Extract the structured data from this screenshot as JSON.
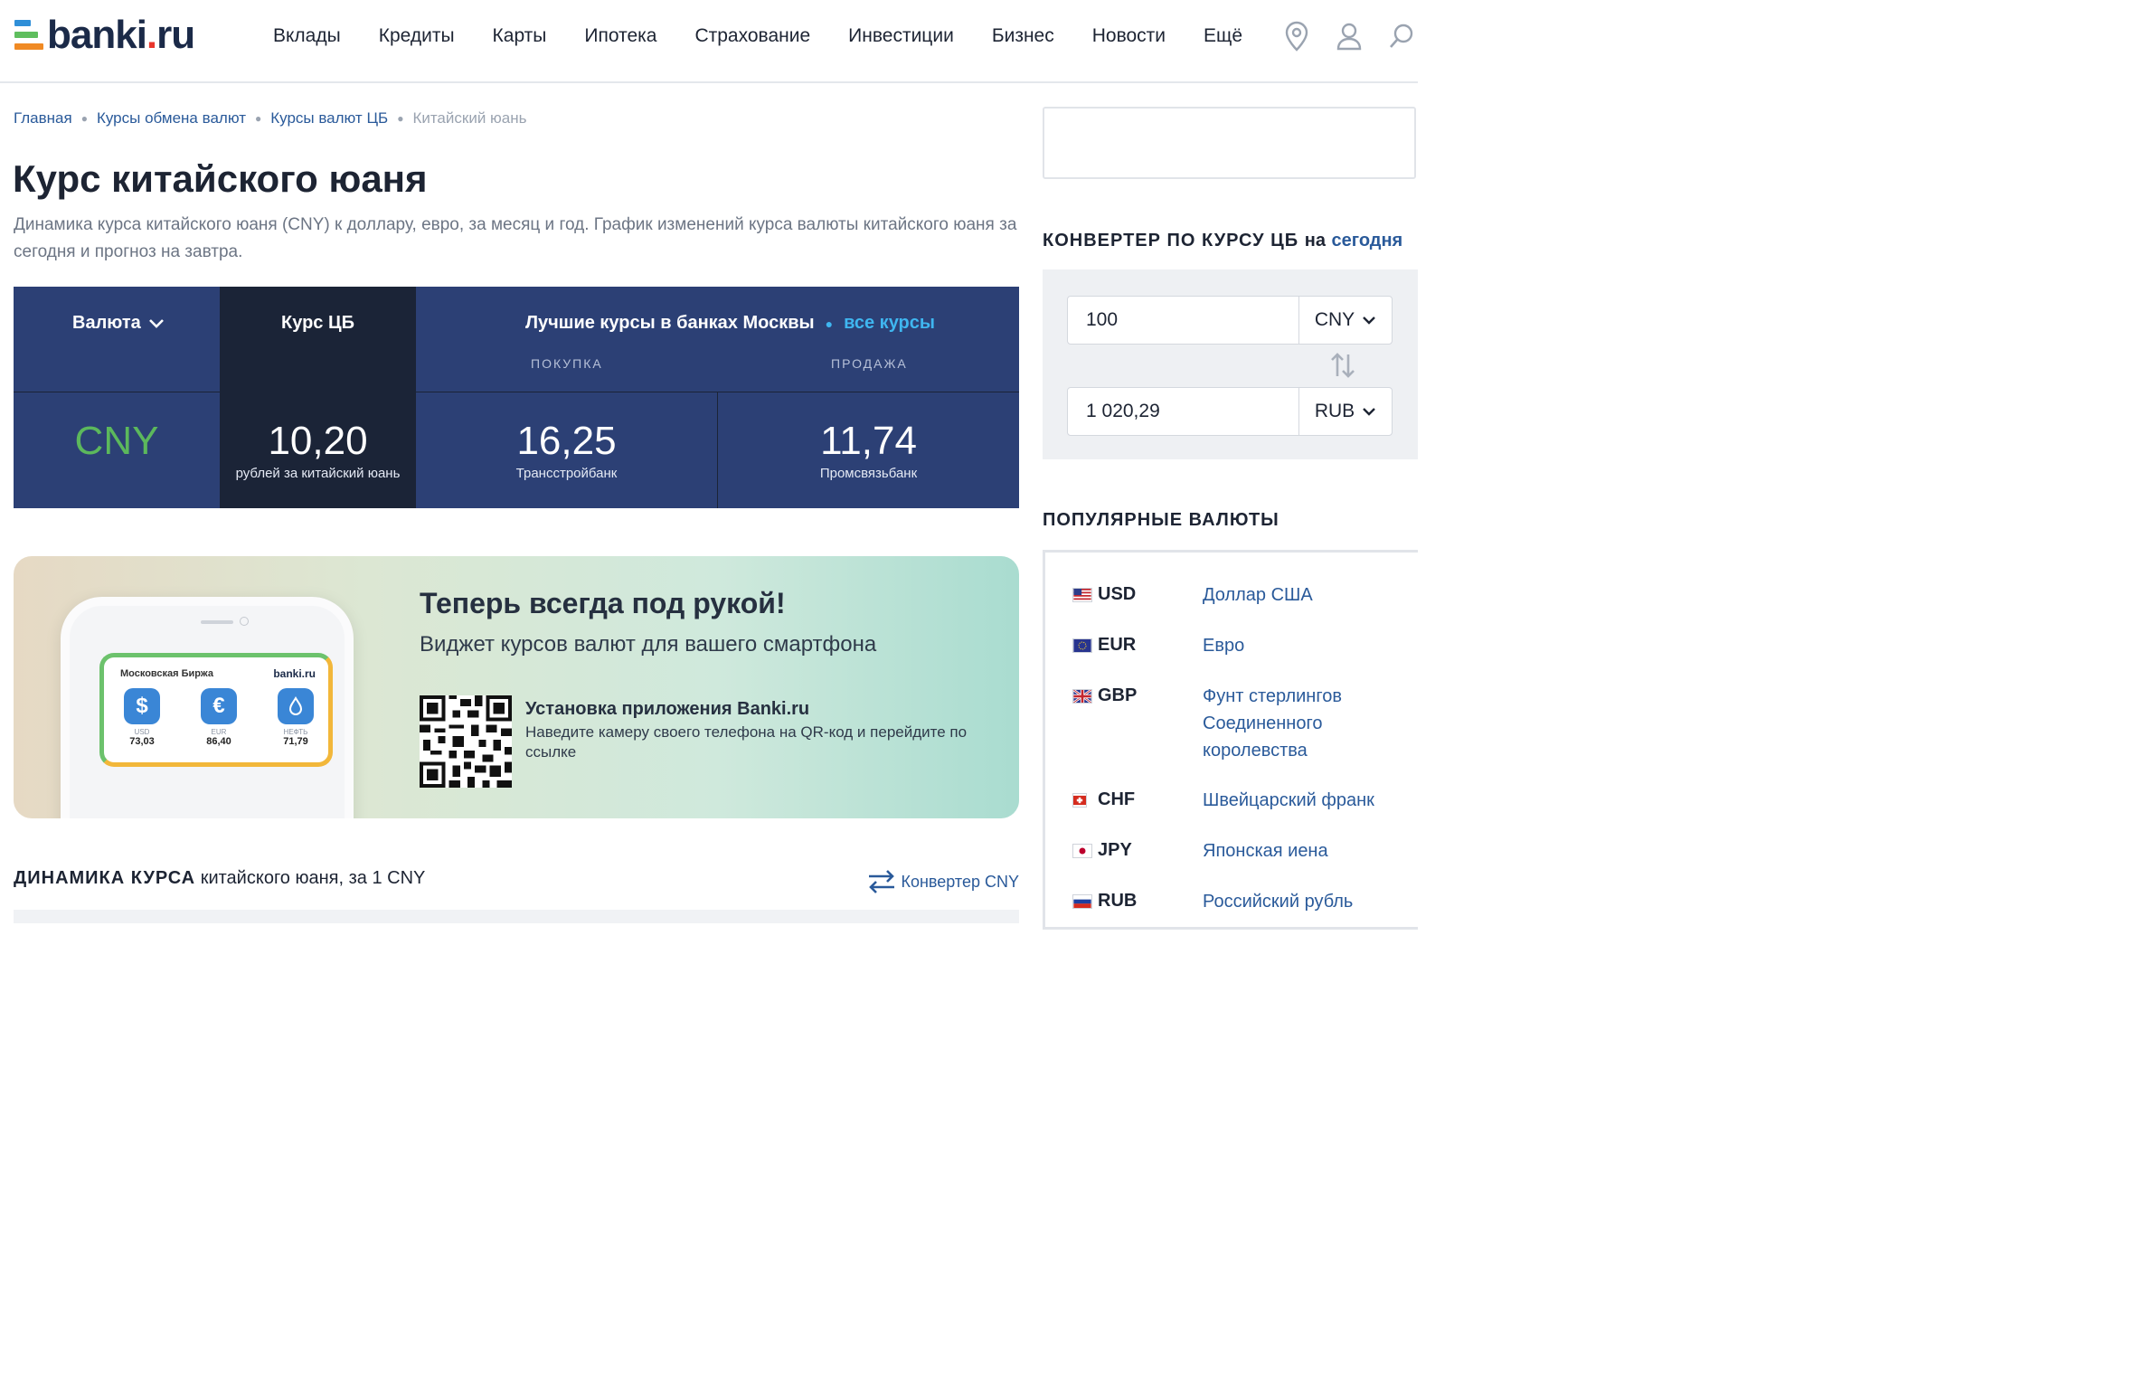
{
  "header": {
    "logo": "banki.ru",
    "nav": [
      "Вклады",
      "Кредиты",
      "Карты",
      "Ипотека",
      "Страхование",
      "Инвестиции",
      "Бизнес",
      "Новости",
      "Ещё"
    ],
    "icons": [
      "location-icon",
      "user-icon",
      "search-icon"
    ]
  },
  "breadcrumb": [
    "Главная",
    "Курсы обмена валют",
    "Курсы валют ЦБ",
    "Китайский юань"
  ],
  "page": {
    "title": "Курс китайского юаня",
    "description": "Динамика курса китайского юаня (CNY) к доллару, евро, за месяц и год. График изменений курса валюты китайского юаня за сегодня и прогноз на завтра."
  },
  "rates": {
    "col_currency": "Валюта",
    "col_cb": "Курс ЦБ",
    "col_best": "Лучшие курсы в банках Москвы",
    "all_rates_link": "все курсы",
    "buy_label": "ПОКУПКА",
    "sell_label": "ПРОДАЖА",
    "currency_code": "CNY",
    "cb_value": "10,20",
    "cb_caption": "рублей за китайский юань",
    "buy_value": "16,25",
    "buy_bank": "Трансстройбанк",
    "sell_value": "11,74",
    "sell_bank": "Промсвязьбанк"
  },
  "promo": {
    "title": "Теперь всегда под рукой!",
    "subtitle": "Виджет курсов валют для вашего смартфона",
    "install_title": "Установка приложения Banki.ru",
    "install_text": "Наведите камеру своего телефона на QR-код и перейдите по ссылке",
    "widget": {
      "exchange": "Московская Биржа",
      "logo": "banki.ru",
      "items": [
        {
          "symbol": "$",
          "label": "USD",
          "value": "73,03"
        },
        {
          "symbol": "€",
          "label": "EUR",
          "value": "86,40"
        },
        {
          "symbol": "💧",
          "label": "НЕФТЬ",
          "value": "71,79"
        }
      ]
    }
  },
  "dynamics": {
    "title_bold": "ДИНАМИКА КУРСА",
    "title_rest": "китайского юаня, за 1 CNY",
    "converter_link": "Конвертер CNY"
  },
  "converter": {
    "title": "КОНВЕРТЕР ПО КУРСУ ЦБ",
    "on": "на",
    "date_link": "сегодня",
    "from_value": "100",
    "from_currency": "CNY",
    "to_value": "1 020,29",
    "to_currency": "RUB"
  },
  "popular": {
    "title": "ПОПУЛЯРНЫЕ ВАЛЮТЫ",
    "items": [
      {
        "code": "USD",
        "name": "Доллар США"
      },
      {
        "code": "EUR",
        "name": "Евро"
      },
      {
        "code": "GBP",
        "name": "Фунт стерлингов Соединенного королевства"
      },
      {
        "code": "CHF",
        "name": "Швейцарский франк"
      },
      {
        "code": "JPY",
        "name": "Японская иена"
      },
      {
        "code": "RUB",
        "name": "Российский рубль"
      }
    ]
  },
  "colors": {
    "brand_blue": "#2c4075",
    "dark": "#1b2437",
    "link": "#2a5a9a",
    "cny_green": "#5cb85c",
    "accent_cyan": "#3fb6f0"
  }
}
